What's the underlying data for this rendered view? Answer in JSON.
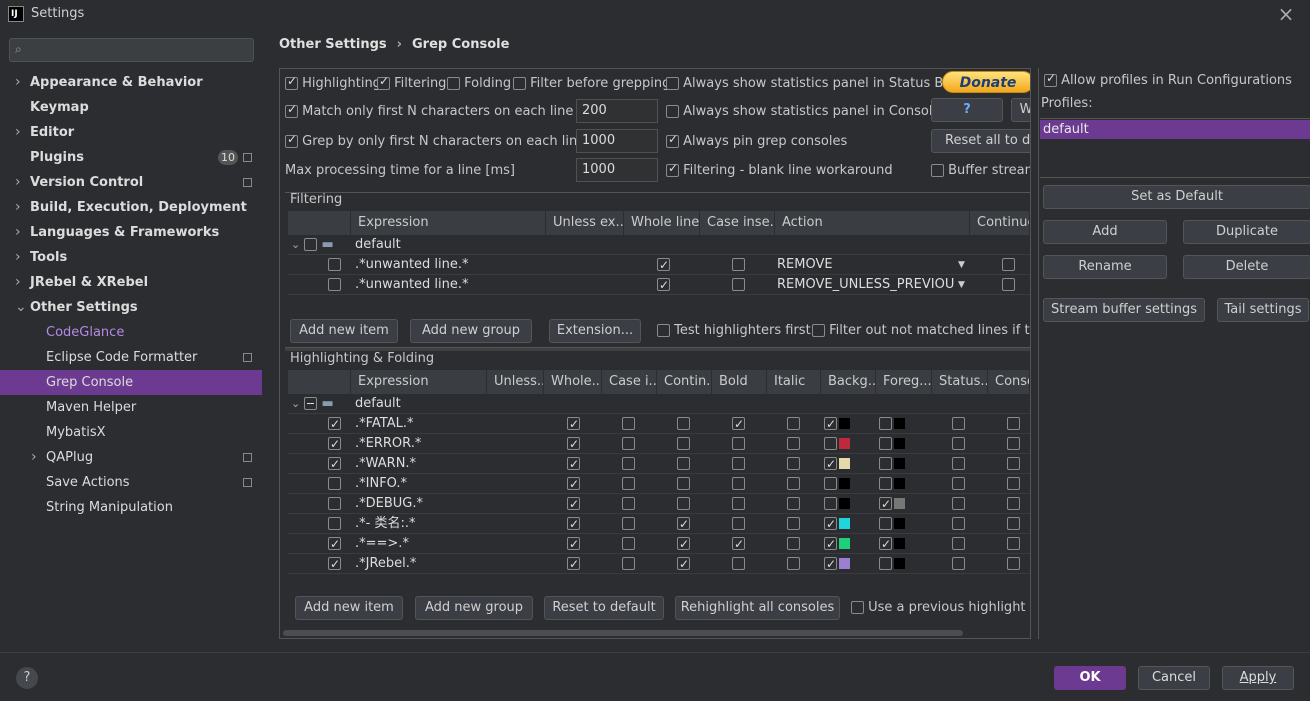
{
  "window": {
    "title": "Settings",
    "app_icon": "IJ"
  },
  "sidebar": {
    "search_placeholder": "",
    "items": [
      {
        "label": "Appearance & Behavior",
        "expandable": true
      },
      {
        "label": "Keymap",
        "expandable": false
      },
      {
        "label": "Editor",
        "expandable": true
      },
      {
        "label": "Plugins",
        "badge": "10"
      },
      {
        "label": "Version Control",
        "expandable": true
      },
      {
        "label": "Build, Execution, Deployment",
        "expandable": true
      },
      {
        "label": "Languages & Frameworks",
        "expandable": true
      },
      {
        "label": "Tools",
        "expandable": true
      },
      {
        "label": "JRebel & XRebel",
        "expandable": true
      },
      {
        "label": "Other Settings",
        "expanded": true
      },
      {
        "label": "CodeGlance",
        "link": true
      },
      {
        "label": "Eclipse Code Formatter"
      },
      {
        "label": "Grep Console",
        "selected": true
      },
      {
        "label": "Maven Helper"
      },
      {
        "label": "MybatisX"
      },
      {
        "label": "QAPlug",
        "expandable": true
      },
      {
        "label": "Save Actions"
      },
      {
        "label": "String Manipulation"
      }
    ]
  },
  "breadcrumb": {
    "parent": "Other Settings",
    "separator": "›",
    "current": "Grep Console"
  },
  "options": {
    "highlighting": "Highlighting",
    "filtering": "Filtering",
    "folding": "Folding",
    "filter_before_grepping": "Filter before grepping",
    "always_stats_status_bar": "Always show statistics panel in Status Bar",
    "donate": "Donate",
    "match_first_n": "Match only first N characters on each line",
    "match_first_n_value": "200",
    "always_stats_console": "Always show statistics panel in Console",
    "help_btn": "?",
    "w_btn": "W",
    "grep_first_n": "Grep by only first N characters on each line",
    "grep_first_n_value": "1000",
    "always_pin": "Always pin grep consoles",
    "reset_all": "Reset all to de",
    "max_processing": "Max processing time for a line [ms]",
    "max_processing_value": "1000",
    "blank_line_workaround": "Filtering - blank line workaround",
    "buffer_stream": "Buffer stream"
  },
  "filtering": {
    "section": "Filtering",
    "headers": [
      "Expression",
      "Unless ex...",
      "Whole line",
      "Case inse...",
      "Action",
      "Continue"
    ],
    "group": "default",
    "rows": [
      {
        "expr": ".*unwanted line.*",
        "whole": true,
        "case": false,
        "action": "REMOVE",
        "cont": false
      },
      {
        "expr": ".*unwanted line.*",
        "whole": true,
        "case": false,
        "action": "REMOVE_UNLESS_PREVIOUS...",
        "cont": false
      }
    ],
    "add_item": "Add new item",
    "add_group": "Add new group",
    "extension": "Extension...",
    "test_highlighters": "Test highlighters first",
    "filter_out": "Filter out not matched lines if the"
  },
  "highlighting": {
    "section": "Highlighting & Folding",
    "headers": [
      "Expression",
      "Unless...",
      "Whole...",
      "Case i...",
      "Contin...",
      "Bold",
      "Italic",
      "Backg...",
      "Foreg...",
      "Status...",
      "Conso"
    ],
    "group": "default",
    "rows": [
      {
        "on": true,
        "expr": ".*FATAL.*",
        "whole": true,
        "case": false,
        "cont": false,
        "bold": true,
        "italic": false,
        "bg_on": true,
        "bg": "#000000",
        "fg_on": false,
        "fg": "#000000"
      },
      {
        "on": true,
        "expr": ".*ERROR.*",
        "whole": true,
        "case": false,
        "cont": false,
        "bold": false,
        "italic": false,
        "bg_on": false,
        "bg": "#c0283c",
        "fg_on": false,
        "fg": "#000000"
      },
      {
        "on": true,
        "expr": ".*WARN.*",
        "whole": true,
        "case": false,
        "cont": false,
        "bold": false,
        "italic": false,
        "bg_on": true,
        "bg": "#e6d8a8",
        "fg_on": false,
        "fg": "#000000"
      },
      {
        "on": false,
        "expr": ".*INFO.*",
        "whole": true,
        "case": false,
        "cont": false,
        "bold": false,
        "italic": false,
        "bg_on": false,
        "bg": "#000000",
        "fg_on": false,
        "fg": "#000000"
      },
      {
        "on": false,
        "expr": ".*DEBUG.*",
        "whole": true,
        "case": false,
        "cont": false,
        "bold": false,
        "italic": false,
        "bg_on": false,
        "bg": "#000000",
        "fg_on": true,
        "fg": "#777777"
      },
      {
        "on": false,
        "expr": ".*- 类名:.*",
        "whole": true,
        "case": false,
        "cont": true,
        "bold": false,
        "italic": false,
        "bg_on": true,
        "bg": "#1fd6dc",
        "fg_on": false,
        "fg": "#000000"
      },
      {
        "on": true,
        "expr": ".*==>.*",
        "whole": true,
        "case": false,
        "cont": true,
        "bold": true,
        "italic": false,
        "bg_on": true,
        "bg": "#1fd07a",
        "fg_on": true,
        "fg": "#000000"
      },
      {
        "on": true,
        "expr": ".*JRebel.*",
        "whole": true,
        "case": false,
        "cont": true,
        "bold": false,
        "italic": false,
        "bg_on": true,
        "bg": "#9b7fd0",
        "fg_on": false,
        "fg": "#000000"
      }
    ],
    "add_item": "Add new item",
    "add_group": "Add new group",
    "reset_default": "Reset to default",
    "rehighlight": "Rehighlight all consoles",
    "use_previous": "Use a previous highlight if a"
  },
  "profiles": {
    "allow": "Allow profiles in Run Configurations",
    "label": "Profiles:",
    "items": [
      "default"
    ],
    "set_default": "Set as Default",
    "add": "Add",
    "duplicate": "Duplicate",
    "rename": "Rename",
    "delete": "Delete",
    "stream_buffer": "Stream buffer settings",
    "tail": "Tail settings"
  },
  "footer": {
    "help": "?",
    "ok": "OK",
    "cancel": "Cancel",
    "apply": "Apply"
  },
  "colors": {
    "accent": "#6c3a91",
    "background": "#2b2d30"
  }
}
